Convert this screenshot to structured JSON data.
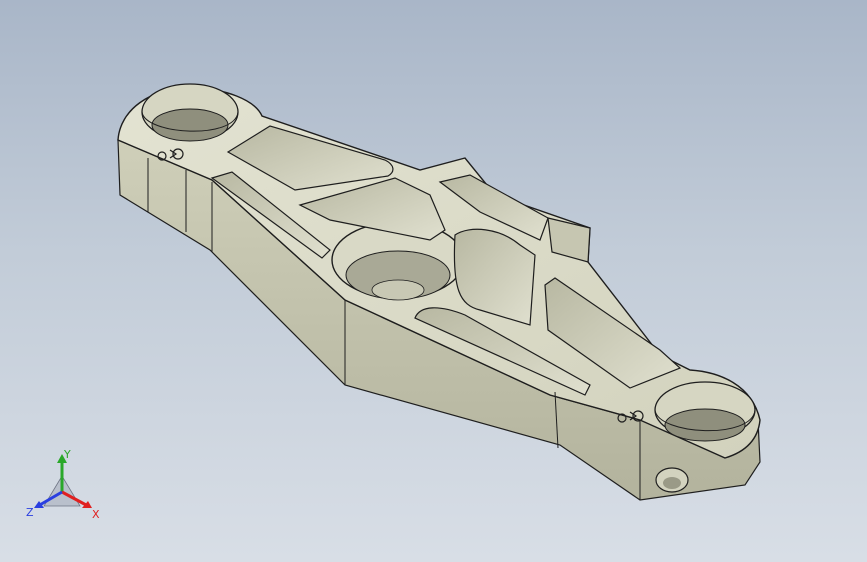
{
  "viewport": {
    "background_top": "#a9b6c8",
    "background_bottom": "#d8dee6"
  },
  "model": {
    "part_color": "#d6d6c2",
    "part_shadow": "#b9b9a4",
    "edge_color": "#1e1e1e"
  },
  "triad": {
    "x_label": "X",
    "y_label": "Y",
    "z_label": "Z",
    "x_color": "#e02020",
    "y_color": "#2aa82a",
    "z_color": "#2a3fe0"
  }
}
